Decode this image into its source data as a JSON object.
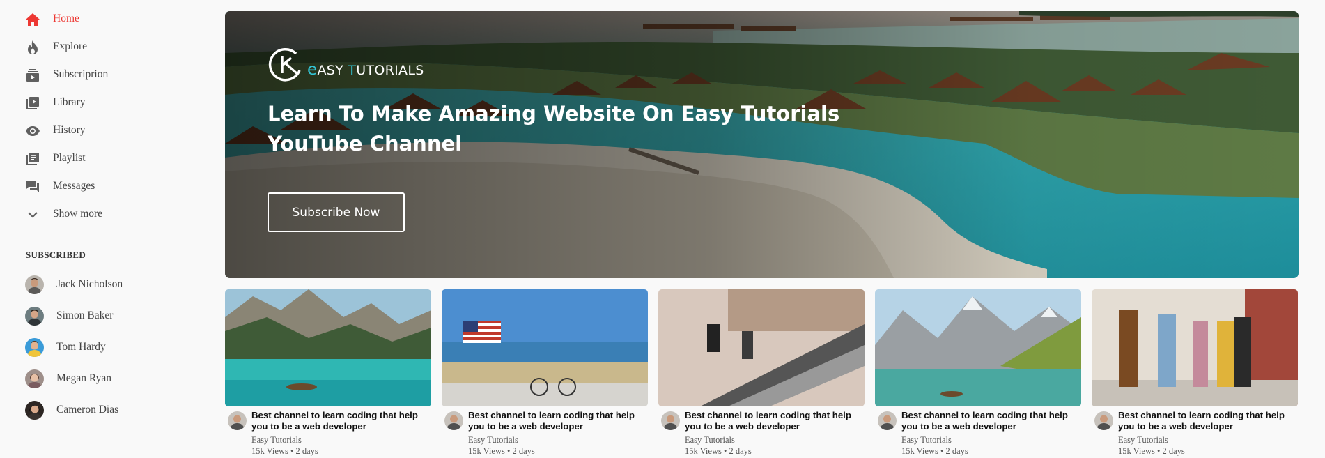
{
  "sidebar": {
    "nav": [
      {
        "label": "Home",
        "icon": "home-icon"
      },
      {
        "label": "Explore",
        "icon": "flame-icon"
      },
      {
        "label": "Subscriprion",
        "icon": "subscriptions-icon"
      },
      {
        "label": "Library",
        "icon": "library-icon"
      },
      {
        "label": "History",
        "icon": "eye-icon"
      },
      {
        "label": "Playlist",
        "icon": "playlist-icon"
      },
      {
        "label": "Messages",
        "icon": "messages-icon"
      },
      {
        "label": "Show more",
        "icon": "chevron-down-icon"
      }
    ],
    "subscribed_heading": "SUBSCRIBED",
    "subscriptions": [
      {
        "name": "Jack Nicholson"
      },
      {
        "name": "Simon Baker"
      },
      {
        "name": "Tom Hardy"
      },
      {
        "name": "Megan Ryan"
      },
      {
        "name": "Cameron Dias"
      }
    ]
  },
  "banner": {
    "logo_e": "e",
    "logo_asy": "ASY ",
    "logo_t": "T",
    "logo_utorials": "UTORIALS",
    "title": "Learn To Make Amazing Website On Easy Tutorials YouTube Channel",
    "button_label": "Subscribe Now"
  },
  "videos": [
    {
      "title": "Best channel to learn coding that help you to be a web developer",
      "channel": "Easy Tutorials",
      "meta": "15k Views • 2 days",
      "scene": "mountain-lake"
    },
    {
      "title": "Best channel to learn coding that help you to be a web developer",
      "channel": "Easy Tutorials",
      "meta": "15k Views • 2 days",
      "scene": "beach-flag-bike"
    },
    {
      "title": "Best channel to learn coding that help you to be a web developer",
      "channel": "Easy Tutorials",
      "meta": "15k Views • 2 days",
      "scene": "mall-escalator"
    },
    {
      "title": "Best channel to learn coding that help you to be a web developer",
      "channel": "Easy Tutorials",
      "meta": "15k Views • 2 days",
      "scene": "alpine-lake"
    },
    {
      "title": "Best channel to learn coding that help you to be a web developer",
      "channel": "Easy Tutorials",
      "meta": "15k Views • 2 days",
      "scene": "friends-walking"
    }
  ],
  "colors": {
    "accent": "#ed3833",
    "brand": "#33c4d5",
    "background": "#f9f9f9"
  }
}
